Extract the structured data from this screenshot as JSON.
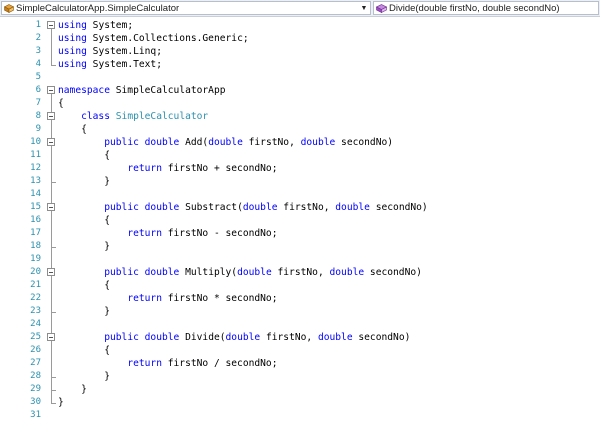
{
  "navigation": {
    "type_dropdown": {
      "value": "SimpleCalculatorApp.SimpleCalculator",
      "icon": "class-icon"
    },
    "member_dropdown": {
      "value": "Divide(double firstNo, double secondNo)",
      "icon": "method-icon"
    }
  },
  "colors": {
    "keyword": "#0000ff",
    "type_name": "#2b91af",
    "line_number": "#2b91af",
    "text": "#000000",
    "background": "#ffffff"
  },
  "code_lines": [
    {
      "num": "1",
      "tokens": [
        [
          "kw",
          "using"
        ],
        [
          "",
          " System;"
        ]
      ]
    },
    {
      "num": "2",
      "tokens": [
        [
          "kw",
          "using"
        ],
        [
          "",
          " System.Collections.Generic;"
        ]
      ]
    },
    {
      "num": "3",
      "tokens": [
        [
          "kw",
          "using"
        ],
        [
          "",
          " System.Linq;"
        ]
      ]
    },
    {
      "num": "4",
      "tokens": [
        [
          "kw",
          "using"
        ],
        [
          "",
          " System.Text;"
        ]
      ]
    },
    {
      "num": "5",
      "tokens": []
    },
    {
      "num": "6",
      "tokens": [
        [
          "kw",
          "namespace"
        ],
        [
          "",
          " SimpleCalculatorApp"
        ]
      ]
    },
    {
      "num": "7",
      "tokens": [
        [
          "",
          "{"
        ]
      ]
    },
    {
      "num": "8",
      "tokens": [
        [
          "",
          "    "
        ],
        [
          "kw",
          "class"
        ],
        [
          "",
          " "
        ],
        [
          "ty",
          "SimpleCalculator"
        ]
      ]
    },
    {
      "num": "9",
      "tokens": [
        [
          "",
          "    {"
        ]
      ]
    },
    {
      "num": "10",
      "tokens": [
        [
          "",
          "        "
        ],
        [
          "kw",
          "public"
        ],
        [
          "",
          " "
        ],
        [
          "kw",
          "double"
        ],
        [
          "",
          " Add("
        ],
        [
          "kw",
          "double"
        ],
        [
          "",
          " firstNo, "
        ],
        [
          "kw",
          "double"
        ],
        [
          "",
          " secondNo)"
        ]
      ]
    },
    {
      "num": "11",
      "tokens": [
        [
          "",
          "        {"
        ]
      ]
    },
    {
      "num": "12",
      "tokens": [
        [
          "",
          "            "
        ],
        [
          "kw",
          "return"
        ],
        [
          "",
          " firstNo + secondNo;"
        ]
      ]
    },
    {
      "num": "13",
      "tokens": [
        [
          "",
          "        }"
        ]
      ]
    },
    {
      "num": "14",
      "tokens": []
    },
    {
      "num": "15",
      "tokens": [
        [
          "",
          "        "
        ],
        [
          "kw",
          "public"
        ],
        [
          "",
          " "
        ],
        [
          "kw",
          "double"
        ],
        [
          "",
          " Substract("
        ],
        [
          "kw",
          "double"
        ],
        [
          "",
          " firstNo, "
        ],
        [
          "kw",
          "double"
        ],
        [
          "",
          " secondNo)"
        ]
      ]
    },
    {
      "num": "16",
      "tokens": [
        [
          "",
          "        {"
        ]
      ]
    },
    {
      "num": "17",
      "tokens": [
        [
          "",
          "            "
        ],
        [
          "kw",
          "return"
        ],
        [
          "",
          " firstNo - secondNo;"
        ]
      ]
    },
    {
      "num": "18",
      "tokens": [
        [
          "",
          "        }"
        ]
      ]
    },
    {
      "num": "19",
      "tokens": []
    },
    {
      "num": "20",
      "tokens": [
        [
          "",
          "        "
        ],
        [
          "kw",
          "public"
        ],
        [
          "",
          " "
        ],
        [
          "kw",
          "double"
        ],
        [
          "",
          " Multiply("
        ],
        [
          "kw",
          "double"
        ],
        [
          "",
          " firstNo, "
        ],
        [
          "kw",
          "double"
        ],
        [
          "",
          " secondNo)"
        ]
      ]
    },
    {
      "num": "21",
      "tokens": [
        [
          "",
          "        {"
        ]
      ]
    },
    {
      "num": "22",
      "tokens": [
        [
          "",
          "            "
        ],
        [
          "kw",
          "return"
        ],
        [
          "",
          " firstNo * secondNo;"
        ]
      ]
    },
    {
      "num": "23",
      "tokens": [
        [
          "",
          "        }"
        ]
      ]
    },
    {
      "num": "24",
      "tokens": []
    },
    {
      "num": "25",
      "tokens": [
        [
          "",
          "        "
        ],
        [
          "kw",
          "public"
        ],
        [
          "",
          " "
        ],
        [
          "kw",
          "double"
        ],
        [
          "",
          " Divide("
        ],
        [
          "kw",
          "double"
        ],
        [
          "",
          " firstNo, "
        ],
        [
          "kw",
          "double"
        ],
        [
          "",
          " secondNo)"
        ]
      ]
    },
    {
      "num": "26",
      "tokens": [
        [
          "",
          "        {"
        ]
      ]
    },
    {
      "num": "27",
      "tokens": [
        [
          "",
          "            "
        ],
        [
          "kw",
          "return"
        ],
        [
          "",
          " firstNo / secondNo;"
        ]
      ]
    },
    {
      "num": "28",
      "tokens": [
        [
          "",
          "        }"
        ]
      ]
    },
    {
      "num": "29",
      "tokens": [
        [
          "",
          "    }"
        ]
      ]
    },
    {
      "num": "30",
      "tokens": [
        [
          "",
          "}"
        ]
      ]
    },
    {
      "num": "31",
      "tokens": []
    }
  ],
  "outline": {
    "fold_markers": [
      "1",
      "6",
      "8",
      "10",
      "15",
      "20",
      "25"
    ],
    "regions": [
      {
        "start": "1",
        "end": "4"
      },
      {
        "start": "6",
        "end": "30"
      },
      {
        "start": "8",
        "end": "29"
      },
      {
        "start": "10",
        "end": "13"
      },
      {
        "start": "15",
        "end": "18"
      },
      {
        "start": "20",
        "end": "23"
      },
      {
        "start": "25",
        "end": "28"
      }
    ]
  }
}
